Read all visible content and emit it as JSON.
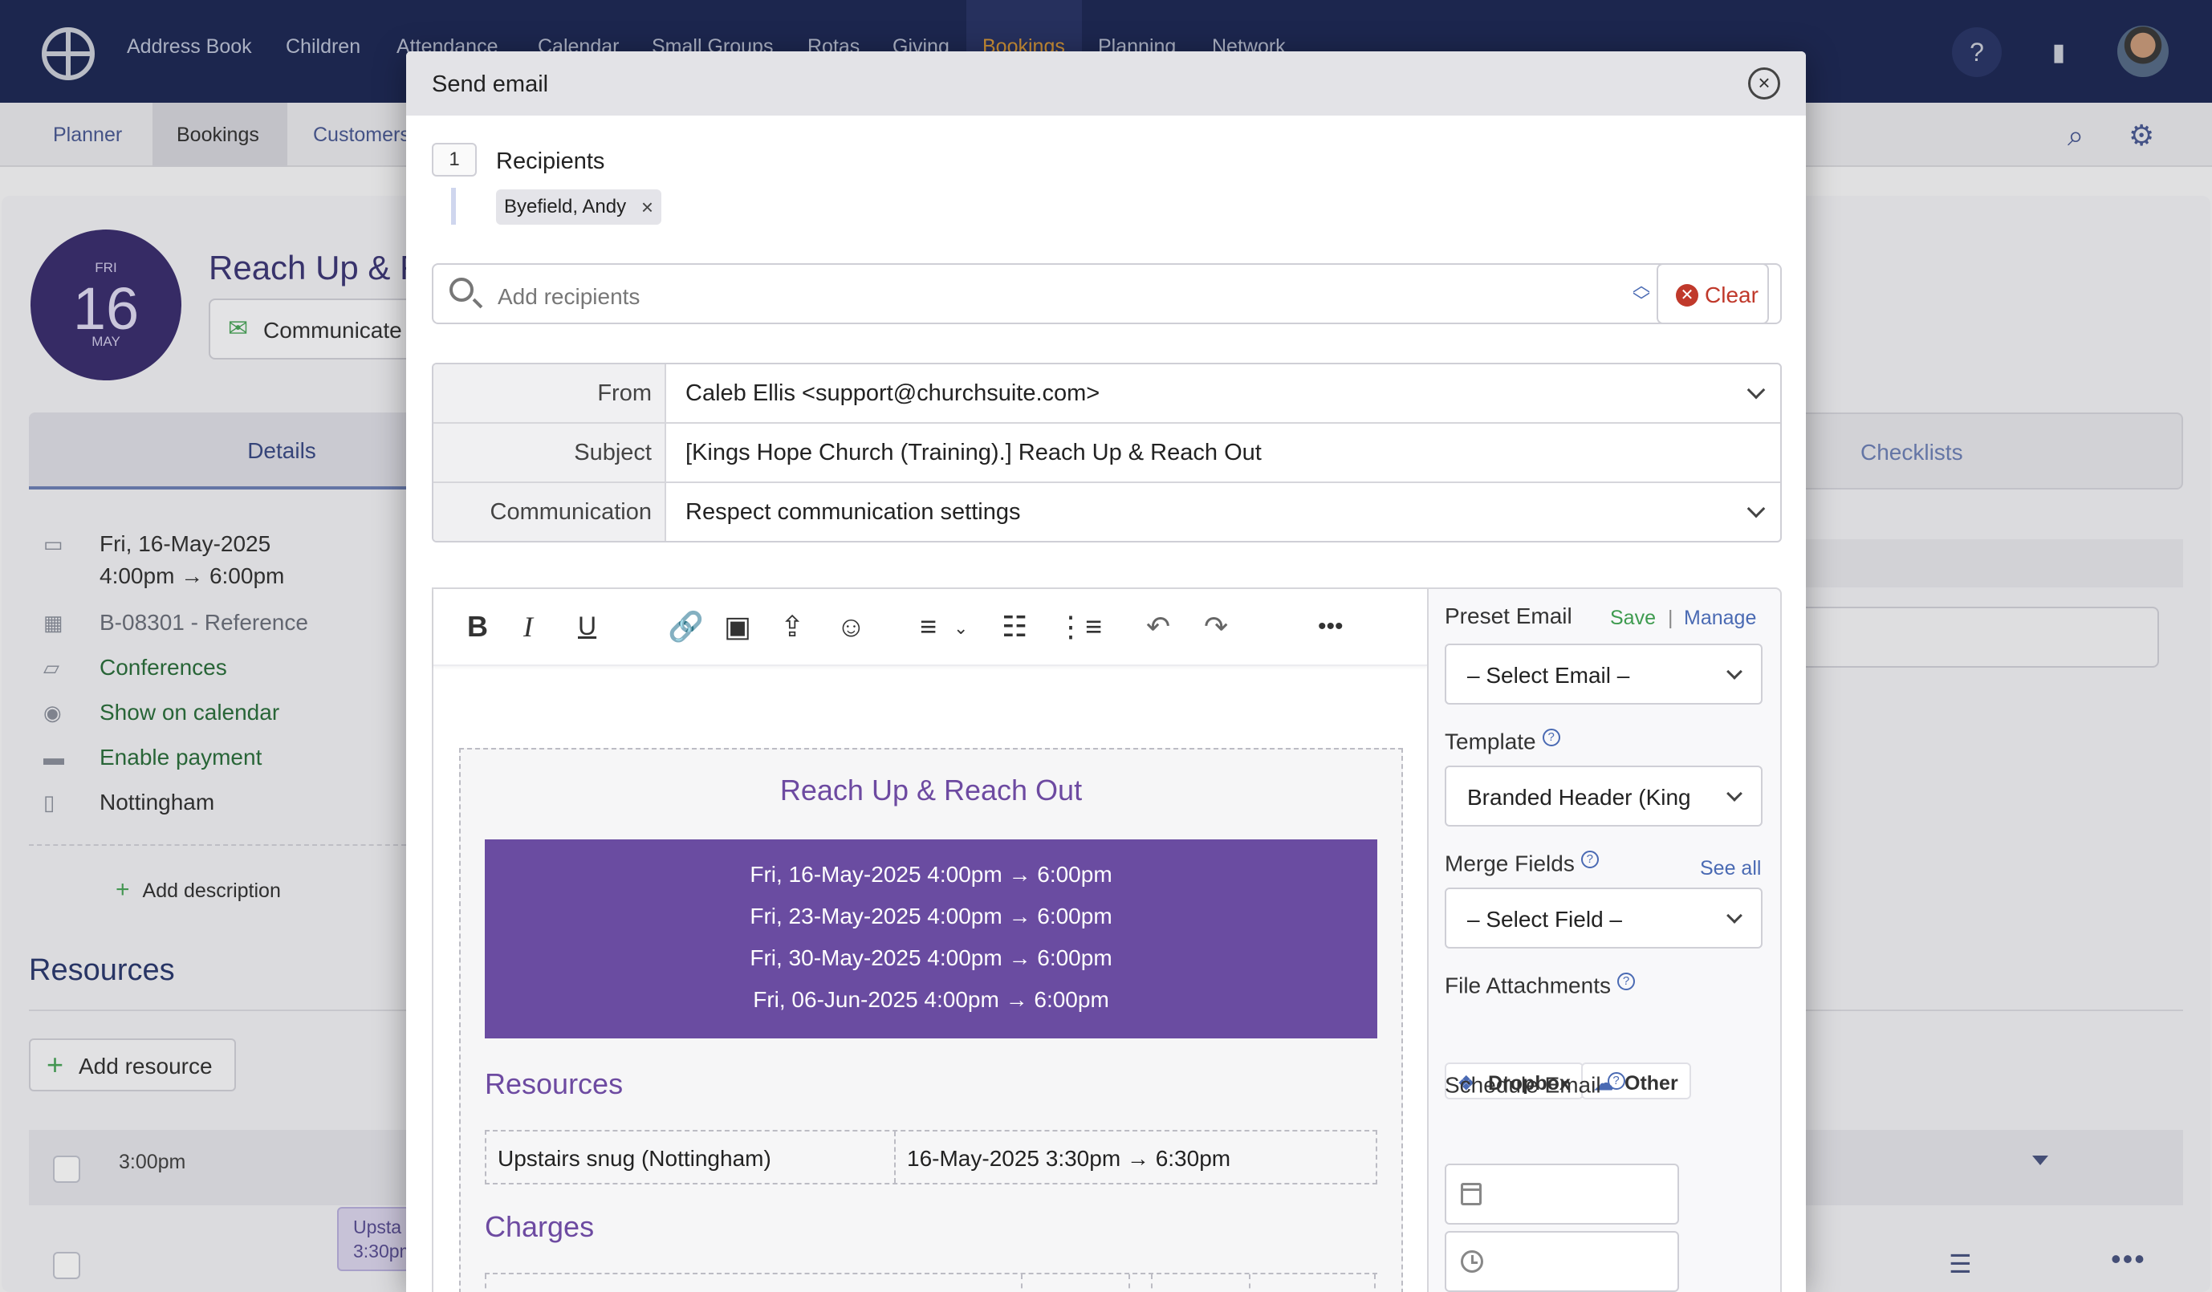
{
  "topnav": {
    "items": [
      "Address Book",
      "Children",
      "Attendance",
      "Calendar",
      "Small Groups",
      "Rotas",
      "Giving",
      "Bookings",
      "Planning",
      "Network"
    ],
    "active_item": "Bookings",
    "help_icon": "question-circle-icon",
    "org_icon": "building-icon"
  },
  "subnav": {
    "items": [
      "Planner",
      "Bookings",
      "Customers"
    ],
    "active_item": "Bookings"
  },
  "background": {
    "date": {
      "dow": "FRI",
      "day": "16",
      "month": "MAY"
    },
    "title": "Reach Up & R",
    "communicate_label": "Communicate",
    "tabs": {
      "details": "Details",
      "checklists": "Checklists"
    },
    "details": {
      "date_line1": "Fri, 16-May-2025",
      "date_line2": "4:00pm  →  6:00pm",
      "reference": "B-08301 - Reference",
      "category": "Conferences",
      "calendar": "Show on calendar",
      "payment": "Enable payment",
      "site": "Nottingham"
    },
    "add_description": "Add description",
    "resources_heading": "Resources",
    "add_resource": "Add resource",
    "time_label": "3:00pm",
    "booking_chip_line1": "Upsta",
    "booking_chip_line2": "3:30pm"
  },
  "modal": {
    "title": "Send email",
    "recipients_count": "1",
    "recipients_label": "Recipients",
    "recipient_chip": "Byefield, Andy",
    "add_recipients_placeholder": "Add recipients",
    "clear_label": "Clear",
    "from_label": "From",
    "from_value": "Caleb Ellis <support@churchsuite.com>",
    "subject_label": "Subject",
    "subject_value": "[Kings Hope Church (Training).] Reach Up & Reach Out",
    "communication_label": "Communication",
    "communication_value": "Respect communication settings"
  },
  "toolbar_icons": [
    "bold-icon",
    "italic-icon",
    "underline-icon",
    "link-icon",
    "image-icon",
    "upload-icon",
    "emoji-icon",
    "align-left-icon",
    "bullet-list-icon",
    "numbered-list-icon",
    "undo-icon",
    "redo-icon",
    "more-icon"
  ],
  "email": {
    "title": "Reach Up & Reach Out",
    "dates": [
      "Fri, 16-May-2025 4:00pm → 6:00pm",
      "Fri, 23-May-2025 4:00pm → 6:00pm",
      "Fri, 30-May-2025 4:00pm → 6:00pm",
      "Fri, 06-Jun-2025 4:00pm → 6:00pm"
    ],
    "resources_heading": "Resources",
    "resource_name": "Upstairs snug (Nottingham)",
    "resource_time": "16-May-2025 3:30pm → 6:30pm",
    "charges_heading": "Charges",
    "banner_color": "#6a4ca1",
    "heading_color": "#6d4aa1"
  },
  "sidebar": {
    "preset_label": "Preset Email",
    "save_link": "Save",
    "manage_link": "Manage",
    "preset_select": "– Select Email –",
    "template_label": "Template",
    "template_select": "Branded Header (King",
    "merge_label": "Merge Fields",
    "see_all_link": "See all",
    "merge_select": "– Select Field –",
    "attachments_label": "File Attachments",
    "dropbox_label": "Dropbox",
    "other_label": "Other",
    "schedule_label": "Schedule Email"
  }
}
